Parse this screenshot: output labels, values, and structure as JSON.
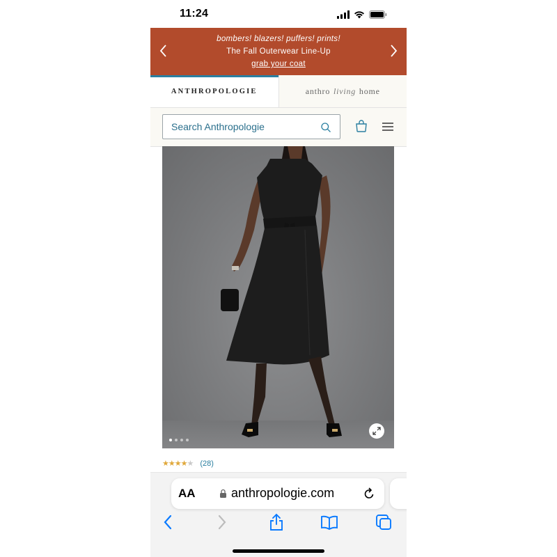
{
  "status_bar": {
    "time": "11:24"
  },
  "promo": {
    "line1": "bombers! blazers! puffers! prints!",
    "line2": "The Fall Outerwear Line-Up",
    "cta": "grab your coat",
    "background": "#b24b2c"
  },
  "brand_tabs": [
    {
      "label": "ANTHROPOLOGIE",
      "active": true
    },
    {
      "label_prefix": "anthro",
      "label_script": "living",
      "label_suffix": "home",
      "active": false
    }
  ],
  "search": {
    "placeholder": "Search Anthropologie"
  },
  "product": {
    "image_description": "black-dress-photo",
    "carousel": {
      "total": 4,
      "active_index": 0
    }
  },
  "rating": {
    "stars": 4,
    "max_stars": 5,
    "review_count": "(28)"
  },
  "browser": {
    "text_size_label": "AA",
    "url": "anthropologie.com"
  },
  "colors": {
    "accent": "#2a7fa0",
    "ios_blue": "#0a7aff"
  }
}
